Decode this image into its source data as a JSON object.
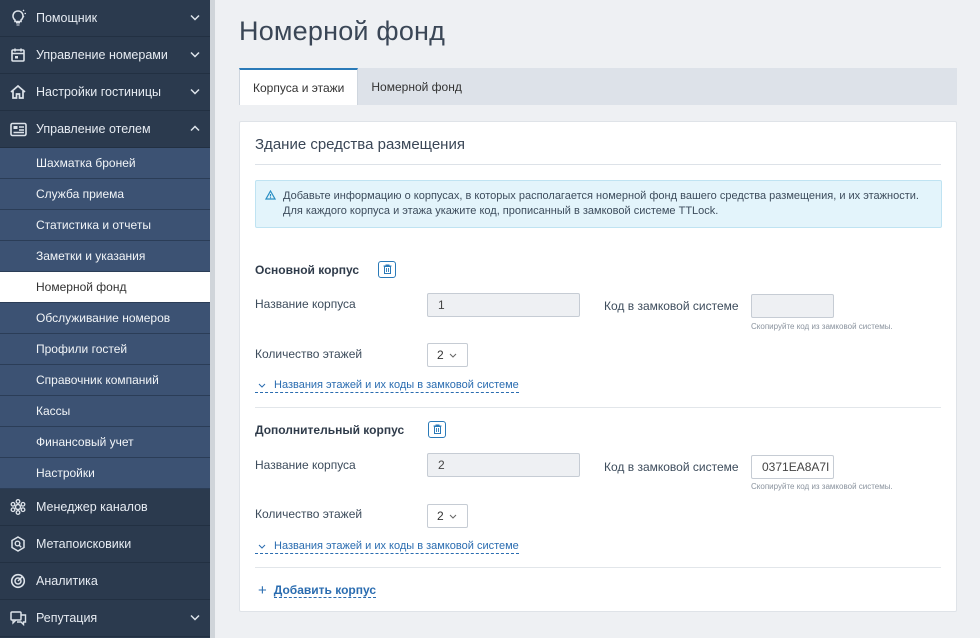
{
  "sidebar": {
    "top_items": [
      {
        "label": "Помощник",
        "icon": "lightbulb-icon"
      },
      {
        "label": "Управление номерами",
        "icon": "calendar-icon"
      },
      {
        "label": "Настройки гостиницы",
        "icon": "home-icon"
      },
      {
        "label": "Управление отелем",
        "icon": "hotel-management-icon"
      }
    ],
    "sub_items": [
      {
        "label": "Шахматка броней"
      },
      {
        "label": "Служба приема"
      },
      {
        "label": "Статистика и отчеты"
      },
      {
        "label": "Заметки и указания"
      },
      {
        "label": "Номерной фонд",
        "active": true
      },
      {
        "label": "Обслуживание номеров"
      },
      {
        "label": "Профили гостей"
      },
      {
        "label": "Справочник компаний"
      },
      {
        "label": "Кассы"
      },
      {
        "label": "Финансовый учет"
      },
      {
        "label": "Настройки"
      }
    ],
    "bottom_items": [
      {
        "label": "Менеджер каналов",
        "icon": "channel-manager-icon"
      },
      {
        "label": "Метапоисковики",
        "icon": "metasearch-icon"
      },
      {
        "label": "Аналитика",
        "icon": "analytics-icon"
      },
      {
        "label": "Репутация",
        "icon": "reputation-icon"
      }
    ]
  },
  "page": {
    "title": "Номерной фонд",
    "tabs": [
      {
        "label": "Корпуса и этажи",
        "active": true
      },
      {
        "label": "Номерной фонд",
        "active": false
      }
    ]
  },
  "card": {
    "title": "Здание средства размещения",
    "info_line1": "Добавьте информацию о корпусах, в которых располагается номерной фонд вашего средства размещения, и их этажности.",
    "info_line2": "Для каждого корпуса и этажа укажите код, прописанный в замковой системе TTLock."
  },
  "buildings": [
    {
      "title": "Основной корпус",
      "name_label": "Название корпуса",
      "name_value": "1",
      "lock_label": "Код в замковой системе",
      "lock_value": "",
      "lock_hint": "Скопируйте код из замковой системы.",
      "floors_label": "Количество этажей",
      "floors_value": "2",
      "floors_toggle": "Названия этажей и их коды в замковой системе"
    },
    {
      "title": "Дополнительный корпус",
      "name_label": "Название корпуса",
      "name_value": "2",
      "lock_label": "Код в замковой системе",
      "lock_value": "0371EA8A7I",
      "lock_hint": "Скопируйте код из замковой системы.",
      "floors_label": "Количество этажей",
      "floors_value": "2",
      "floors_toggle": "Названия этажей и их коды в замковой системе"
    }
  ],
  "add_building": "Добавить корпус",
  "colors": {
    "sidebar_bg": "#2b3a4e",
    "submenu_bg": "#3c5273",
    "accent": "#2a7ab8",
    "info_bg": "#e3f4fb"
  }
}
